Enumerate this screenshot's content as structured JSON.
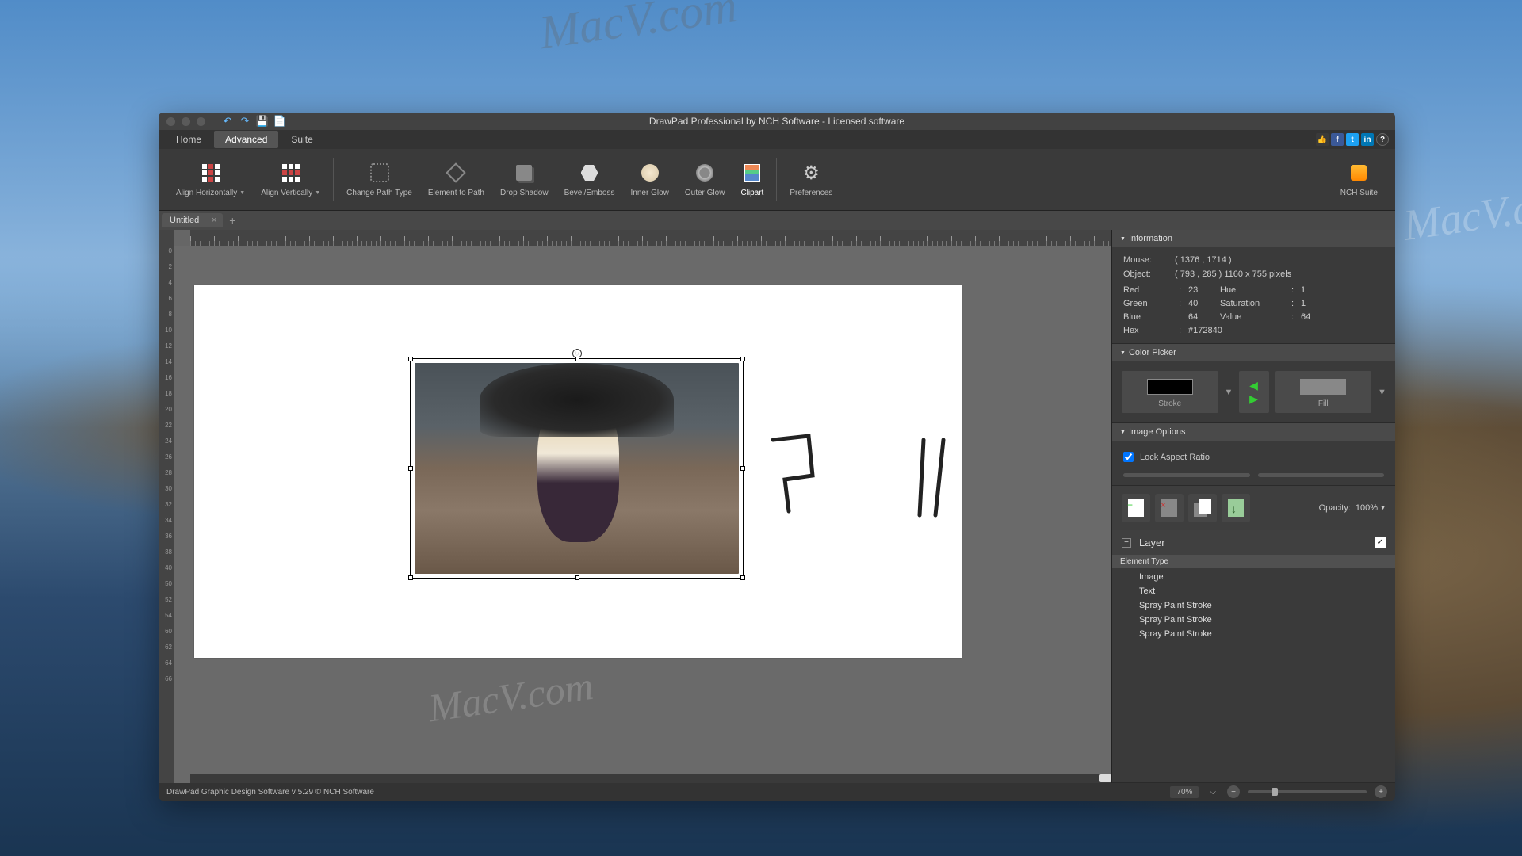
{
  "window": {
    "title": "DrawPad Professional by NCH Software - Licensed software"
  },
  "menu": {
    "tabs": [
      "Home",
      "Advanced",
      "Suite"
    ],
    "active": "Advanced"
  },
  "ribbon": {
    "align_h": "Align Horizontally",
    "align_v": "Align Vertically",
    "change_path": "Change Path Type",
    "elem_path": "Element to Path",
    "drop_shadow": "Drop Shadow",
    "bevel": "Bevel/Emboss",
    "inner_glow": "Inner Glow",
    "outer_glow": "Outer Glow",
    "clipart": "Clipart",
    "preferences": "Preferences",
    "suite": "NCH Suite"
  },
  "doc_tab": "Untitled",
  "panels": {
    "information": {
      "title": "Information",
      "mouse_label": "Mouse:",
      "mouse_val": "( 1376 , 1714 )",
      "object_label": "Object:",
      "object_val": "( 793 , 285 ) 1160 x 755 pixels",
      "red_label": "Red",
      "red_val": "23",
      "green_label": "Green",
      "green_val": "40",
      "blue_label": "Blue",
      "blue_val": "64",
      "hex_label": "Hex",
      "hex_val": "#172840",
      "hue_label": "Hue",
      "hue_val": "1",
      "sat_label": "Saturation",
      "sat_val": "1",
      "val_label": "Value",
      "val_val": "64"
    },
    "color_picker": {
      "title": "Color Picker",
      "stroke": "Stroke",
      "fill": "Fill"
    },
    "image_options": {
      "title": "Image Options",
      "lock_aspect": "Lock Aspect Ratio"
    },
    "layers": {
      "opacity_label": "Opacity:",
      "opacity_val": "100%",
      "layer_label": "Layer",
      "elem_type": "Element Type",
      "items": [
        "Image",
        "Text",
        "Spray Paint Stroke",
        "Spray Paint Stroke",
        "Spray Paint Stroke"
      ]
    }
  },
  "ruler_v": [
    "0",
    "2",
    "4",
    "6",
    "8",
    "10",
    "12",
    "14",
    "16",
    "18",
    "20",
    "22",
    "24",
    "26",
    "28",
    "30",
    "32",
    "34",
    "36",
    "38",
    "40",
    "50",
    "52",
    "54",
    "60",
    "62",
    "64",
    "66"
  ],
  "status": {
    "text": "DrawPad Graphic Design Software v 5.29 © NCH Software",
    "zoom": "70%"
  }
}
